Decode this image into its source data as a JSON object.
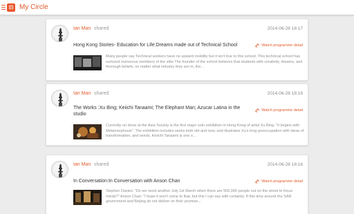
{
  "app": {
    "title": "My Circle",
    "logo_glyph": "⊡",
    "accent_color": "#e05a2b"
  },
  "feed": {
    "shared_label": "shared",
    "watch_label": "Watch programme detail",
    "posts": [
      {
        "author": "Ian Man",
        "timestamp": "2014-06-28 18:17",
        "title": "Hong Kong Stories- Education for Life:Dreams made out of Technical School",
        "excerpt": "Many people say Technical workers have no upward mobility but it isn't true to this school. This technical school has nurtured numerous members of the elite The founder of the school believes that students with creativity, dreams, and thorough beliefs, no matter what industry they are in, the..."
      },
      {
        "author": "Ian Man",
        "timestamp": "2014-06-28 18:16",
        "title": "The Works :Xu Bing; Keiichi Tanaami; The Elephant Man; Azucar Latina in the studio",
        "excerpt": "Currently on show at the Asia Society is the first major solo exhibition in Hong Kong of artist Xu Bing. \"It begins with Metamorphosis\". The exhibition includes works both old and new, and illustrates Xu's long preoccupation with ideas of transformation, and words. Keiichi Tanaami is one o..."
      },
      {
        "author": "Ian Man",
        "timestamp": "2014-06-28 18:16",
        "title": "In Conversation:In Conversation with Anson Chan",
        "excerpt": "Stephen Davies: \"Do we need another July 1st March when there are 500,000 people out on the street to focus minds?\" Anson Chan: \"I hope it won't come to that, but this I can say with certainty: If this time around the SAR government and Beijing do not deliver on their promise..."
      }
    ]
  }
}
